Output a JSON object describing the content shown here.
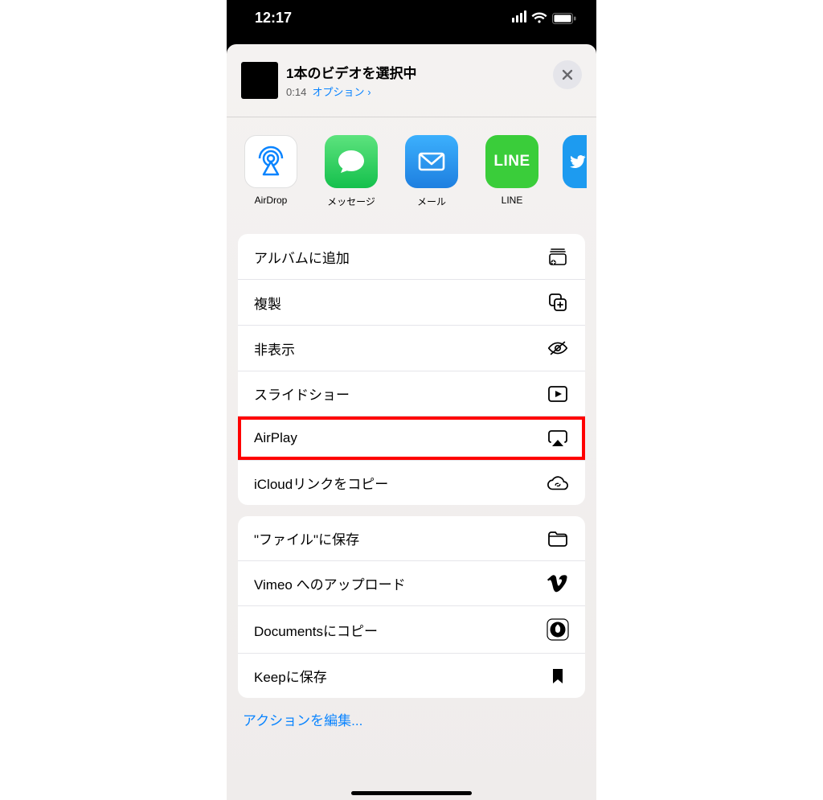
{
  "statusbar": {
    "time": "12:17"
  },
  "header": {
    "title": "1本のビデオを選択中",
    "duration": "0:14",
    "options_label": "オプション",
    "options_chevron": "›"
  },
  "apps": {
    "airdrop": "AirDrop",
    "message": "メッセージ",
    "mail": "メール",
    "line": "LINE",
    "line_text": "LINE",
    "twitter_partial": "T"
  },
  "actions_group1": {
    "add_to_album": "アルバムに追加",
    "duplicate": "複製",
    "hide": "非表示",
    "slideshow": "スライドショー",
    "airplay": "AirPlay",
    "icloud_link": "iCloudリンクをコピー"
  },
  "actions_group2": {
    "save_to_files": "\"ファイル\"に保存",
    "upload_vimeo": "Vimeo へのアップロード",
    "copy_documents": "Documentsにコピー",
    "save_keep": "Keepに保存"
  },
  "edit_actions": "アクションを編集..."
}
